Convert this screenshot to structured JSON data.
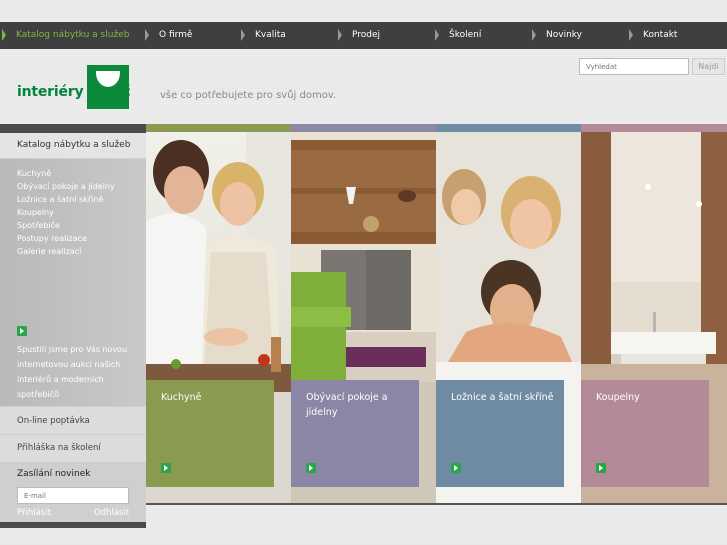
{
  "nav": {
    "items": [
      {
        "label": "Katalog nábytku a služeb",
        "active": true
      },
      {
        "label": "O firmě"
      },
      {
        "label": "Kvalita"
      },
      {
        "label": "Prodej"
      },
      {
        "label": "Školení"
      },
      {
        "label": "Novinky"
      },
      {
        "label": "Kontakt"
      }
    ]
  },
  "search": {
    "placeholder": "Vyhledat",
    "button": "Najdi"
  },
  "brand": {
    "logo_text": "interiéry vorač",
    "tagline": "vše co potřebujete pro svůj domov."
  },
  "sidebar": {
    "heading": "Katalog nábytku a služeb",
    "links": [
      "Kuchyně",
      "Obývací pokoje a jídelny",
      "Ložnice a šatní skříně",
      "Koupelny",
      "Spotřebiče",
      "Postupy realizace",
      "Galerie realizací"
    ],
    "promo": "Spustili jsme pro Vás novou internetovou aukci našich interiérů a moderních spotřebičů",
    "online_request": "On-line poptávka",
    "training_signup": "Přihláška na školení",
    "newsletter": {
      "title": "Zasílání novinek",
      "email_placeholder": "E-mail",
      "subscribe": "Přihlásit",
      "unsubscribe": "Odhlásit"
    }
  },
  "panels": [
    {
      "caption": "Kuchyně",
      "strip_color": "#8a9a50",
      "box_color": "#8a9a4f"
    },
    {
      "caption": "Obývací pokoje a jídelny",
      "strip_color": "#8b87a6",
      "box_color": "#8b86a6"
    },
    {
      "caption": "Ložnice a šatní skříně",
      "strip_color": "#6f8ba5",
      "box_color": "#6f8aa3"
    },
    {
      "caption": "Koupelny",
      "strip_color": "#b38a98",
      "box_color": "#b48a99"
    }
  ],
  "colors": {
    "accent_green": "#2aa64a",
    "logo_green": "#0a8a3a",
    "nav_bg": "#3f3f3f"
  }
}
